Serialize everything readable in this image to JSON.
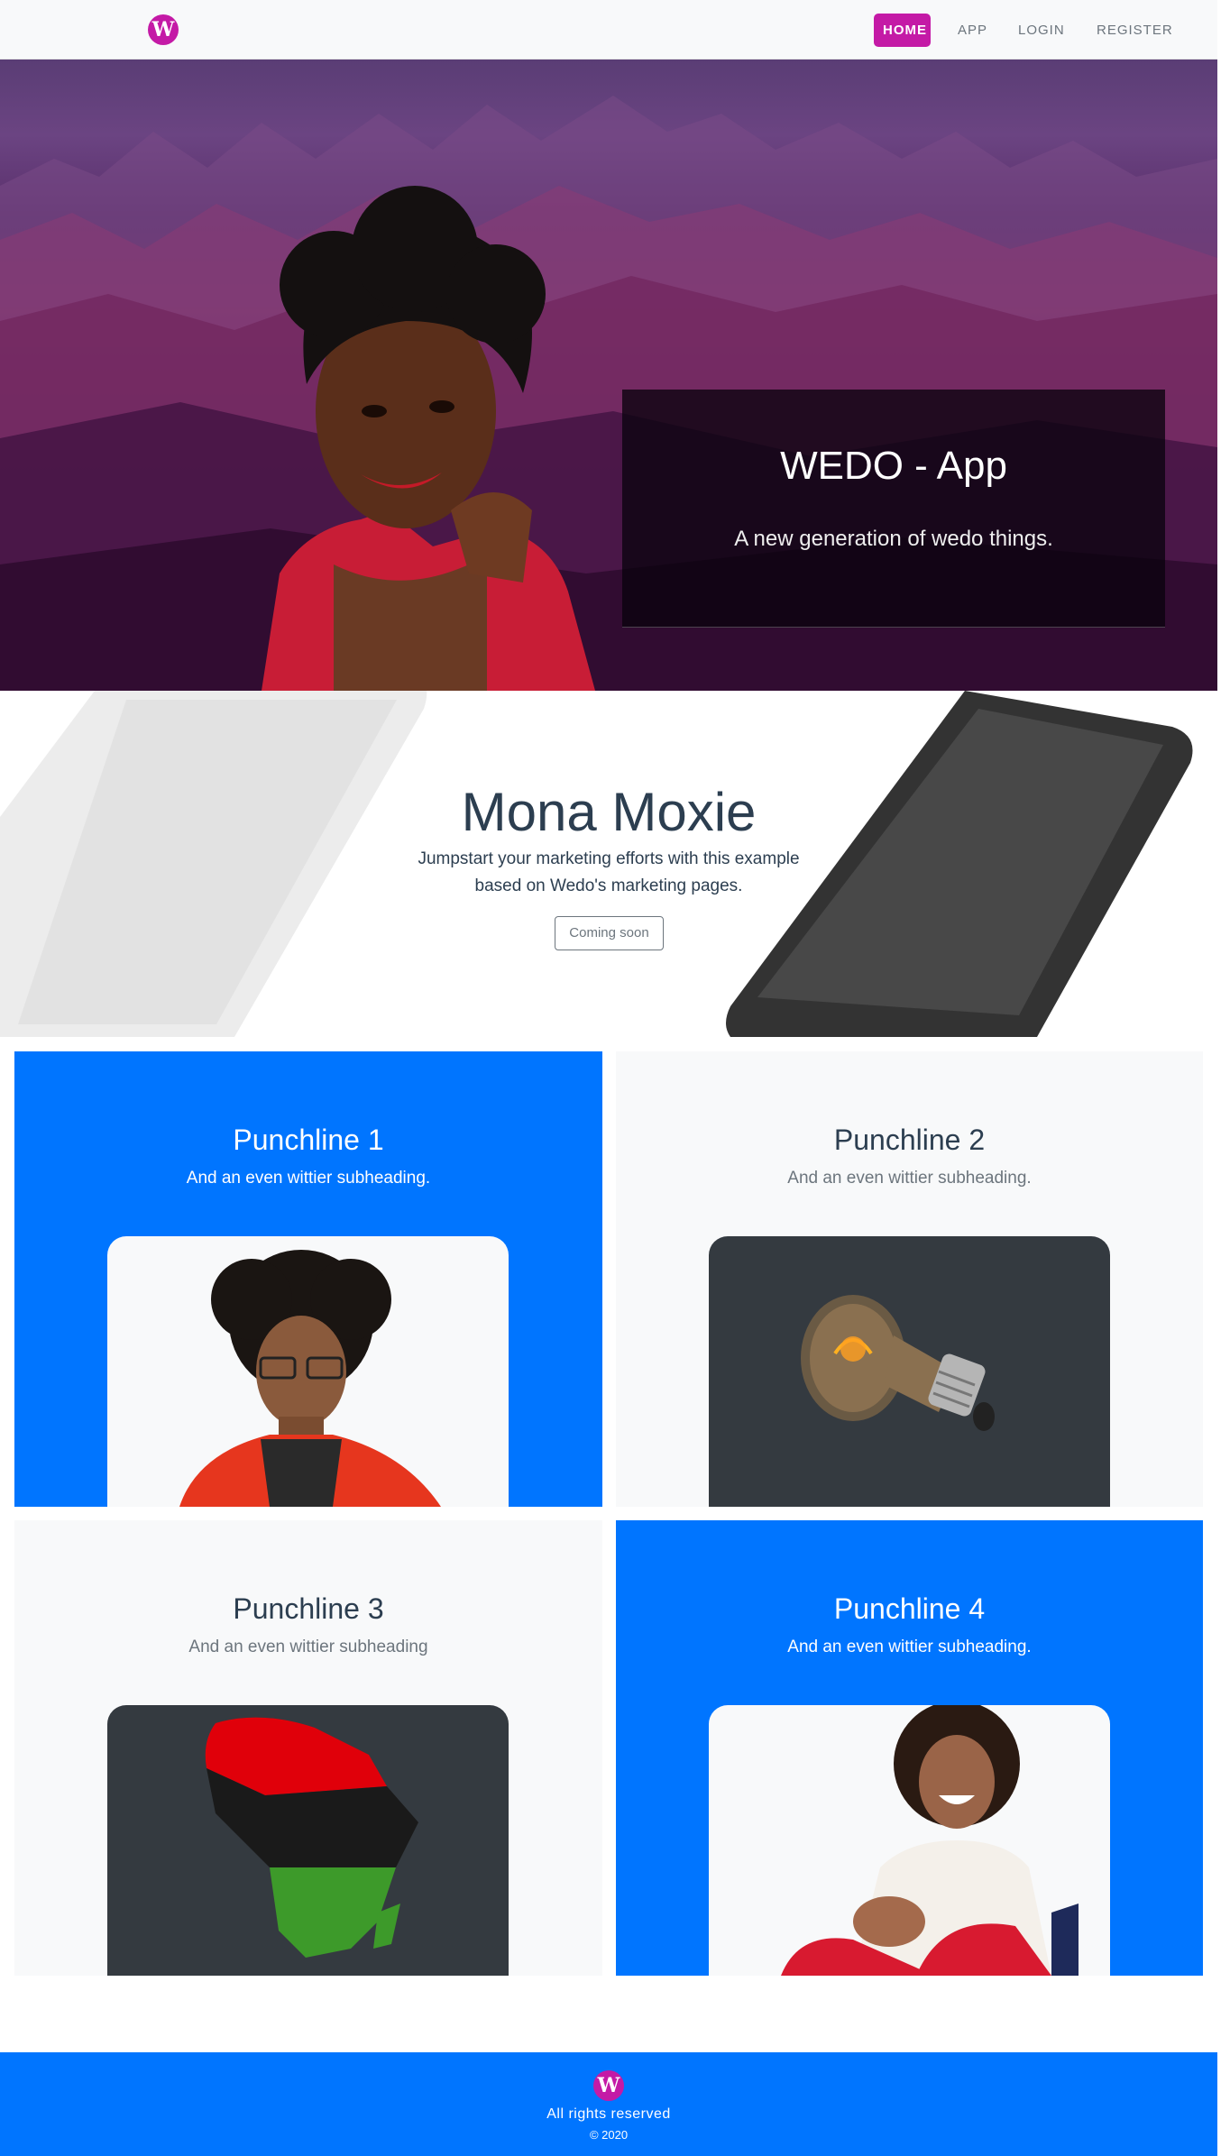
{
  "brand": {
    "logo_icon": "wedo-logo-icon",
    "logo_letter": "W",
    "color": "#c41aa6"
  },
  "nav": {
    "home": "Home",
    "app": "App",
    "login": "Login",
    "register": "Register",
    "active": "Home"
  },
  "hero": {
    "title": "WEDO - App",
    "subtitle": "A new generation of wedo things."
  },
  "promo": {
    "title": "Mona Moxie",
    "text": "Jumpstart your marketing efforts with this example based on Wedo's marketing pages.",
    "button": "Coming soon"
  },
  "features": [
    {
      "title": "Punchline 1",
      "subtitle": "And an even wittier subheading.",
      "image": "young-man-portrait"
    },
    {
      "title": "Punchline 2",
      "subtitle": "And an even wittier subheading.",
      "image": "lightbulb"
    },
    {
      "title": "Punchline 3",
      "subtitle": "And an even wittier subheading",
      "image": "africa-map-flag"
    },
    {
      "title": "Punchline 4",
      "subtitle": "And an even wittier subheading.",
      "image": "laughing-woman"
    }
  ],
  "footer": {
    "rights": "All rights reserved",
    "year": "© 2020"
  },
  "colors": {
    "primary_blue": "#0075ff",
    "light_bg": "#f8f9fa",
    "dark_card": "#343a40",
    "accent_magenta": "#c41aa6"
  }
}
